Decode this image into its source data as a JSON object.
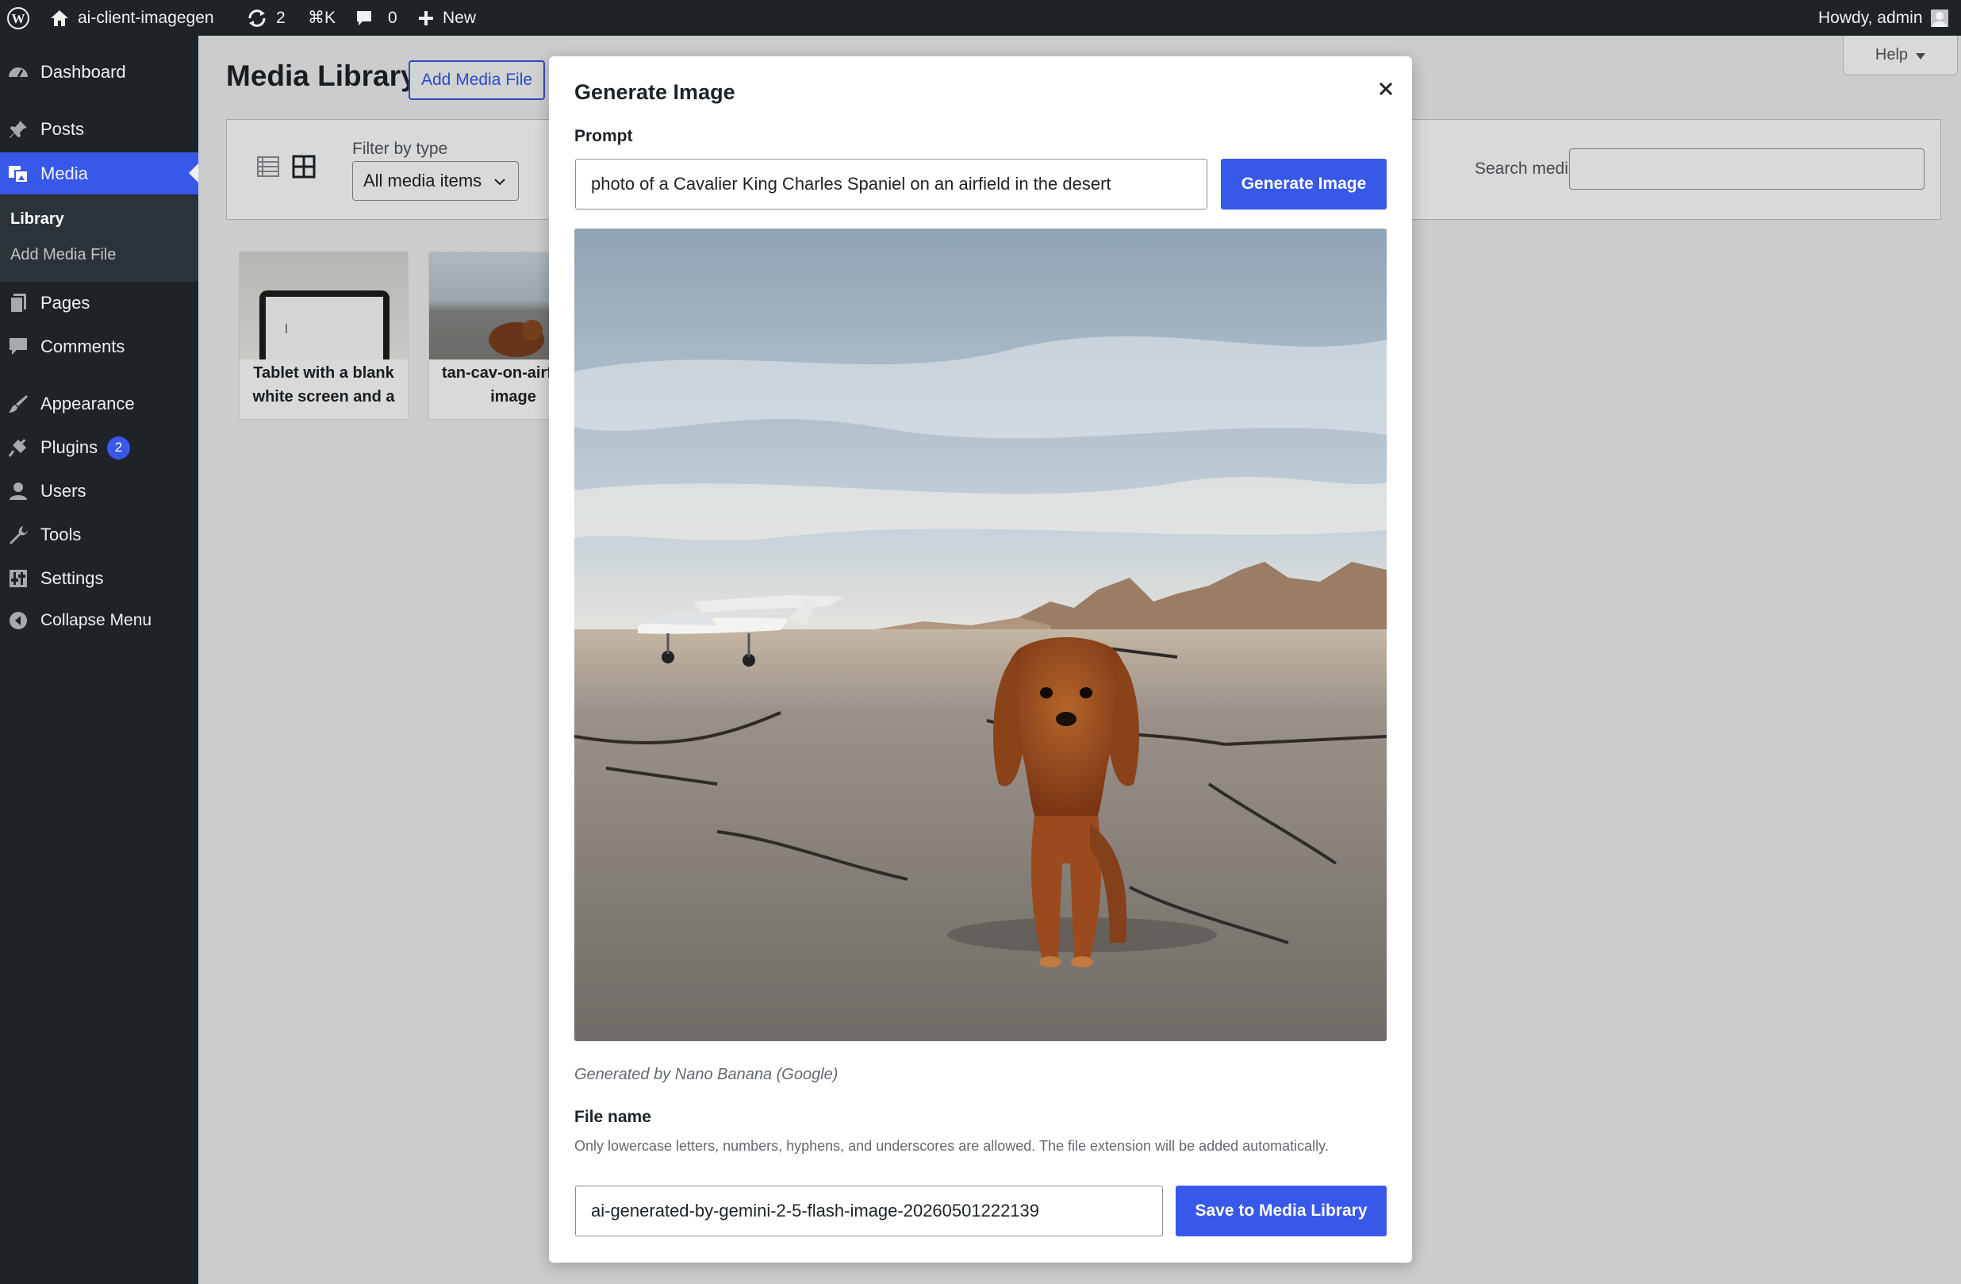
{
  "admin_bar": {
    "site_name": "ai-client-imagegen",
    "updates_count": "2",
    "command_shortcut": "⌘K",
    "comments_count": "0",
    "new_label": "New",
    "greeting": "Howdy, admin"
  },
  "sidebar": {
    "items": [
      {
        "label": "Dashboard",
        "icon": "dashboard-icon"
      },
      {
        "label": "Posts",
        "icon": "pin-icon"
      },
      {
        "label": "Media",
        "icon": "media-icon"
      },
      {
        "label": "Pages",
        "icon": "pages-icon"
      },
      {
        "label": "Comments",
        "icon": "comment-icon"
      },
      {
        "label": "Appearance",
        "icon": "brush-icon"
      },
      {
        "label": "Plugins",
        "icon": "plugin-icon",
        "badge": "2"
      },
      {
        "label": "Users",
        "icon": "user-icon"
      },
      {
        "label": "Tools",
        "icon": "wrench-icon"
      },
      {
        "label": "Settings",
        "icon": "settings-icon"
      },
      {
        "label": "Collapse Menu",
        "icon": "collapse-icon"
      }
    ],
    "submenu": [
      "Library",
      "Add Media File"
    ]
  },
  "page": {
    "title": "Media Library",
    "add_button": "Add Media File",
    "help_label": "Help",
    "filter_label": "Filter by type",
    "filter_value": "All media items",
    "search_label": "Search media",
    "attachments": [
      {
        "caption": "Tablet with a blank white screen and a"
      },
      {
        "caption": "tan-cav-on-airfield-image"
      }
    ]
  },
  "modal": {
    "title": "Generate Image",
    "prompt_label": "Prompt",
    "prompt_value": "photo of a Cavalier King Charles Spaniel on an airfield in the desert",
    "generate_button": "Generate Image",
    "attribution": "Generated by Nano Banana (Google)",
    "filename_label": "File name",
    "filename_help": "Only lowercase letters, numbers, hyphens, and underscores are allowed. The file extension will be added automatically.",
    "filename_value": "ai-generated-by-gemini-2-5-flash-image-20260501222139",
    "save_button": "Save to Media Library"
  },
  "colors": {
    "accent": "#3858e9",
    "admin_bar": "#1d2327",
    "sidebar": "#1d2327",
    "submenu": "#2c3338"
  }
}
